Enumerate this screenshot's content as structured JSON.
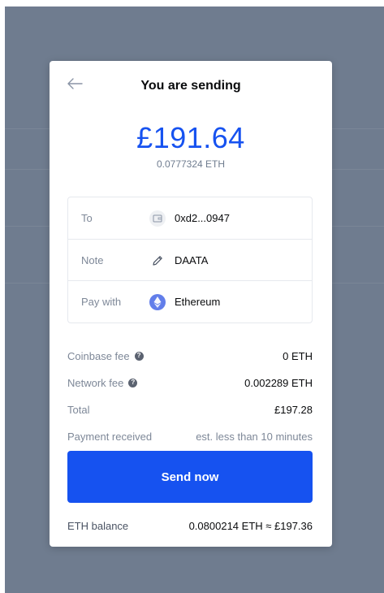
{
  "modal": {
    "title": "You are sending",
    "amount": "£191.64",
    "amount_crypto": "0.0777324 ETH"
  },
  "details": {
    "to": {
      "label": "To",
      "value": "0xd2...0947",
      "icon": "wallet-icon"
    },
    "note": {
      "label": "Note",
      "value": "DAATA",
      "icon": "pencil-icon"
    },
    "pay_with": {
      "label": "Pay with",
      "value": "Ethereum",
      "icon": "ethereum-icon"
    }
  },
  "fees": {
    "coinbase_fee": {
      "label": "Coinbase fee",
      "value": "0 ETH"
    },
    "network_fee": {
      "label": "Network fee",
      "value": "0.002289 ETH"
    },
    "total": {
      "label": "Total",
      "value": "£197.28"
    },
    "payment_received": {
      "label": "Payment received",
      "value": "est. less than 10 minutes"
    },
    "help_glyph": "?"
  },
  "actions": {
    "send_label": "Send now"
  },
  "balance": {
    "label": "ETH balance",
    "value": "0.0800214 ETH ≈ £197.36"
  },
  "colors": {
    "accent": "#1652f0",
    "backdrop": "#6f7c8f",
    "ethereum": "#627eea"
  }
}
